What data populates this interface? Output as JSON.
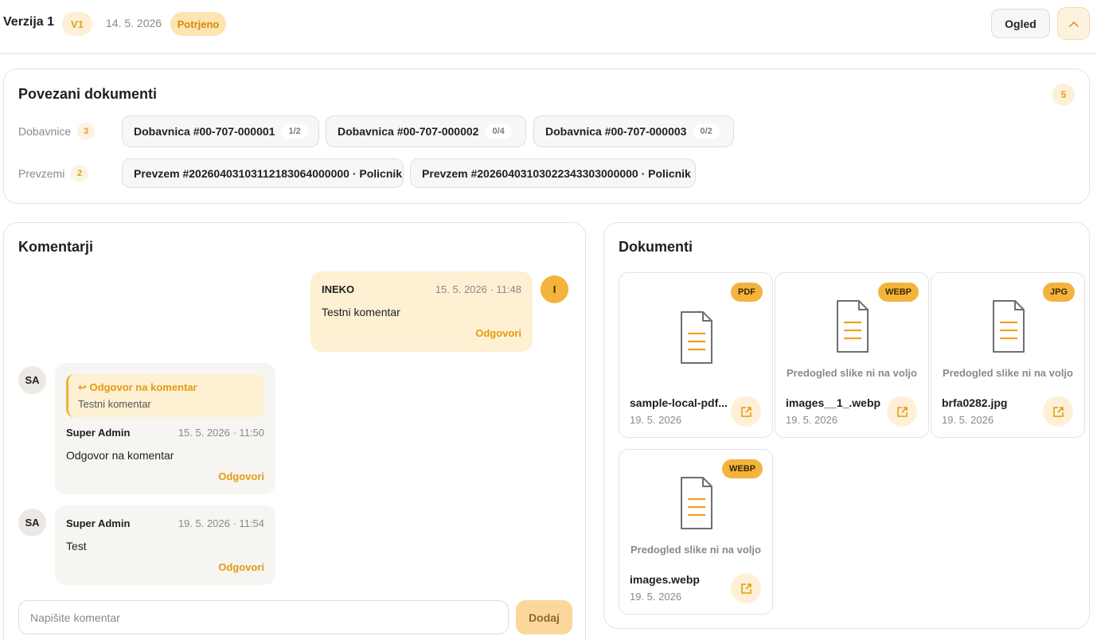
{
  "header": {
    "title": "Verzija 1",
    "version_badge": "V1",
    "date": "14. 5. 2026",
    "status": "Potrjeno",
    "view_button": "Ogled",
    "collapse_icon": "chevron-up-icon"
  },
  "related": {
    "title": "Povezani dokumenti",
    "total": "5",
    "delivery": {
      "label": "Dobavnice",
      "count": "3",
      "items": [
        {
          "label": "Dobavnica #00-707-000001",
          "progress": "1/2"
        },
        {
          "label": "Dobavnica #00-707-000002",
          "progress": "0/4"
        },
        {
          "label": "Dobavnica #00-707-000003",
          "progress": "0/2"
        }
      ]
    },
    "receipts": {
      "label": "Prevzemi",
      "count": "2",
      "items": [
        {
          "label": "Prevzem #20260403103112183064000000 · Policnik"
        },
        {
          "label": "Prevzem #20260403103022343303000000 · Policnik"
        }
      ]
    }
  },
  "comments": {
    "title": "Komentarji",
    "items": [
      {
        "author": "INEKO",
        "avatar": "I",
        "time": "15. 5. 2026 · 11:48",
        "text": "Testni komentar",
        "reply": "Odgovori"
      },
      {
        "author": "Super Admin",
        "avatar": "SA",
        "time": "15. 5. 2026 · 11:50",
        "text": "Odgovor na komentar",
        "reply": "Odgovori",
        "quote_title": "Odgovor na komentar",
        "quote_text": "Testni komentar"
      },
      {
        "author": "Super Admin",
        "avatar": "SA",
        "time": "19. 5. 2026 · 11:54",
        "text": "Test",
        "reply": "Odgovori"
      }
    ],
    "input_placeholder": "Napišite komentar",
    "add_button": "Dodaj"
  },
  "documents": {
    "title": "Dokumenti",
    "items": [
      {
        "type": "PDF",
        "name": "sample-local-pdf...",
        "date": "19. 5. 2026",
        "preview": ""
      },
      {
        "type": "WEBP",
        "name": "images__1_.webp",
        "date": "19. 5. 2026",
        "preview": "Predogled slike ni na voljo"
      },
      {
        "type": "JPG",
        "name": "brfa0282.jpg",
        "date": "19. 5. 2026",
        "preview": "Predogled slike ni na voljo"
      },
      {
        "type": "WEBP",
        "name": "images.webp",
        "date": "19. 5. 2026",
        "preview": "Predogled slike ni na voljo"
      }
    ]
  },
  "colors": {
    "accent": "#f3b33d",
    "accent_text": "#e69a10",
    "accent_soft": "#fdf0d3"
  }
}
